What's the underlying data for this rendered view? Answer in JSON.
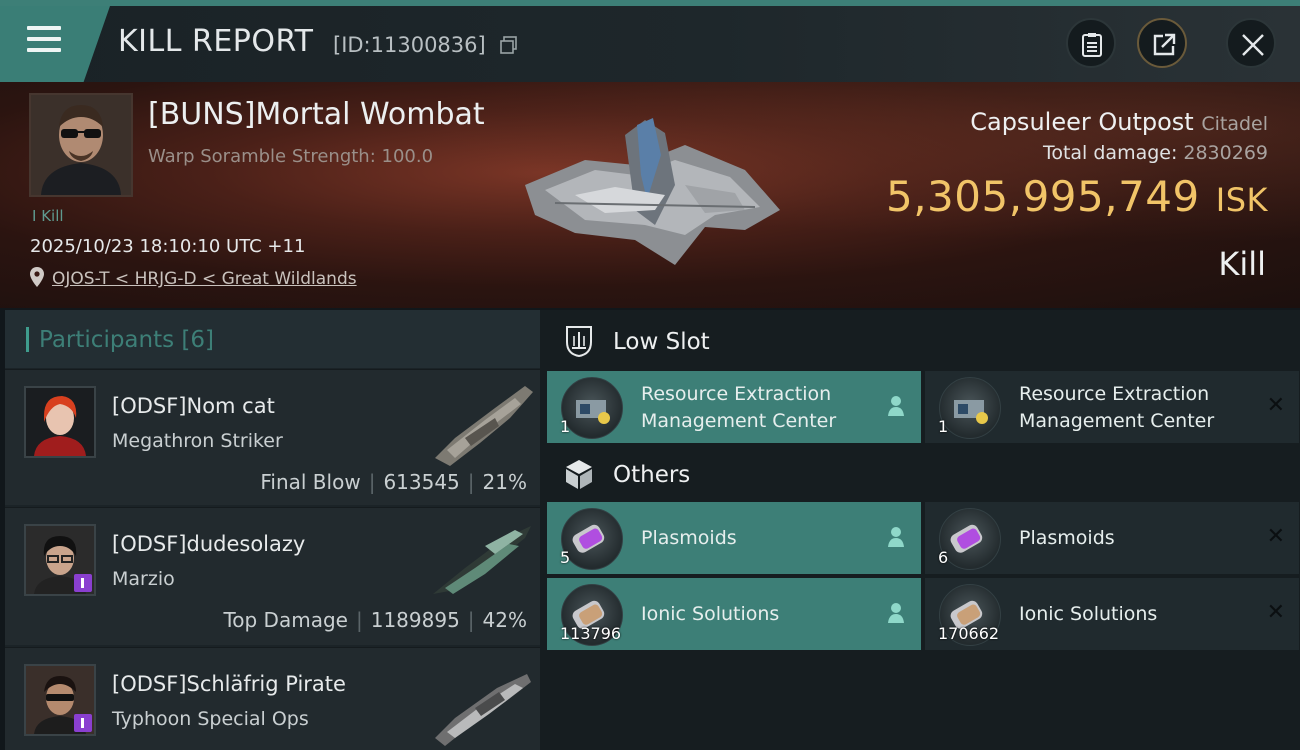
{
  "header": {
    "title": "KILL REPORT",
    "report_id": "[ID:11300836]",
    "buttons": [
      "clipboard-icon",
      "share-icon",
      "close-icon"
    ]
  },
  "victim": {
    "name": "[BUNS]Mortal Wombat",
    "warp_scramble": "Warp Soramble Strength: 100.0",
    "kills_label": "I Kill",
    "datetime": "2025/10/23 18:10:10 UTC +11",
    "location": "OJOS-T < HRJG-D < Great Wildlands"
  },
  "structure": {
    "name": "Capsuleer Outpost",
    "type": "Citadel",
    "total_damage_label": "Total damage:",
    "total_damage": "2830269",
    "isk_value": "5,305,995,749",
    "isk_unit": "ISK",
    "result": "Kill"
  },
  "participants": {
    "title": "Participants",
    "count": "[6]",
    "rows": [
      {
        "name": "[ODSF]Nom cat",
        "ship": "Megathron Striker",
        "role": "Final Blow",
        "damage": "613545",
        "percent": "21%"
      },
      {
        "name": "[ODSF]dudesolazy",
        "ship": "Marzio",
        "role": "Top Damage",
        "damage": "1189895",
        "percent": "42%"
      },
      {
        "name": "[ODSF]Schläfrig Pirate",
        "ship": "Typhoon Special Ops",
        "role": "",
        "damage": "",
        "percent": ""
      }
    ]
  },
  "loot": {
    "sections": [
      {
        "title": "Low Slot",
        "icon": "low-slot-icon",
        "dropped": {
          "name_line1": "Resource Extraction",
          "name_line2": "Management Center",
          "qty": "1"
        },
        "destroyed": {
          "name_line1": "Resource Extraction",
          "name_line2": "Management Center",
          "qty": "1"
        }
      },
      {
        "title": "Others",
        "icon": "cube-icon",
        "rows": [
          {
            "dropped": {
              "name": "Plasmoids",
              "qty": "5"
            },
            "destroyed": {
              "name": "Plasmoids",
              "qty": "6"
            }
          },
          {
            "dropped": {
              "name": "Ionic Solutions",
              "qty": "113796"
            },
            "destroyed": {
              "name": "Ionic Solutions",
              "qty": "170662"
            }
          }
        ]
      }
    ]
  },
  "colors": {
    "accent_teal": "#3d7f77",
    "isk_gold": "#f1c468",
    "banner_red": "#4a2018"
  }
}
